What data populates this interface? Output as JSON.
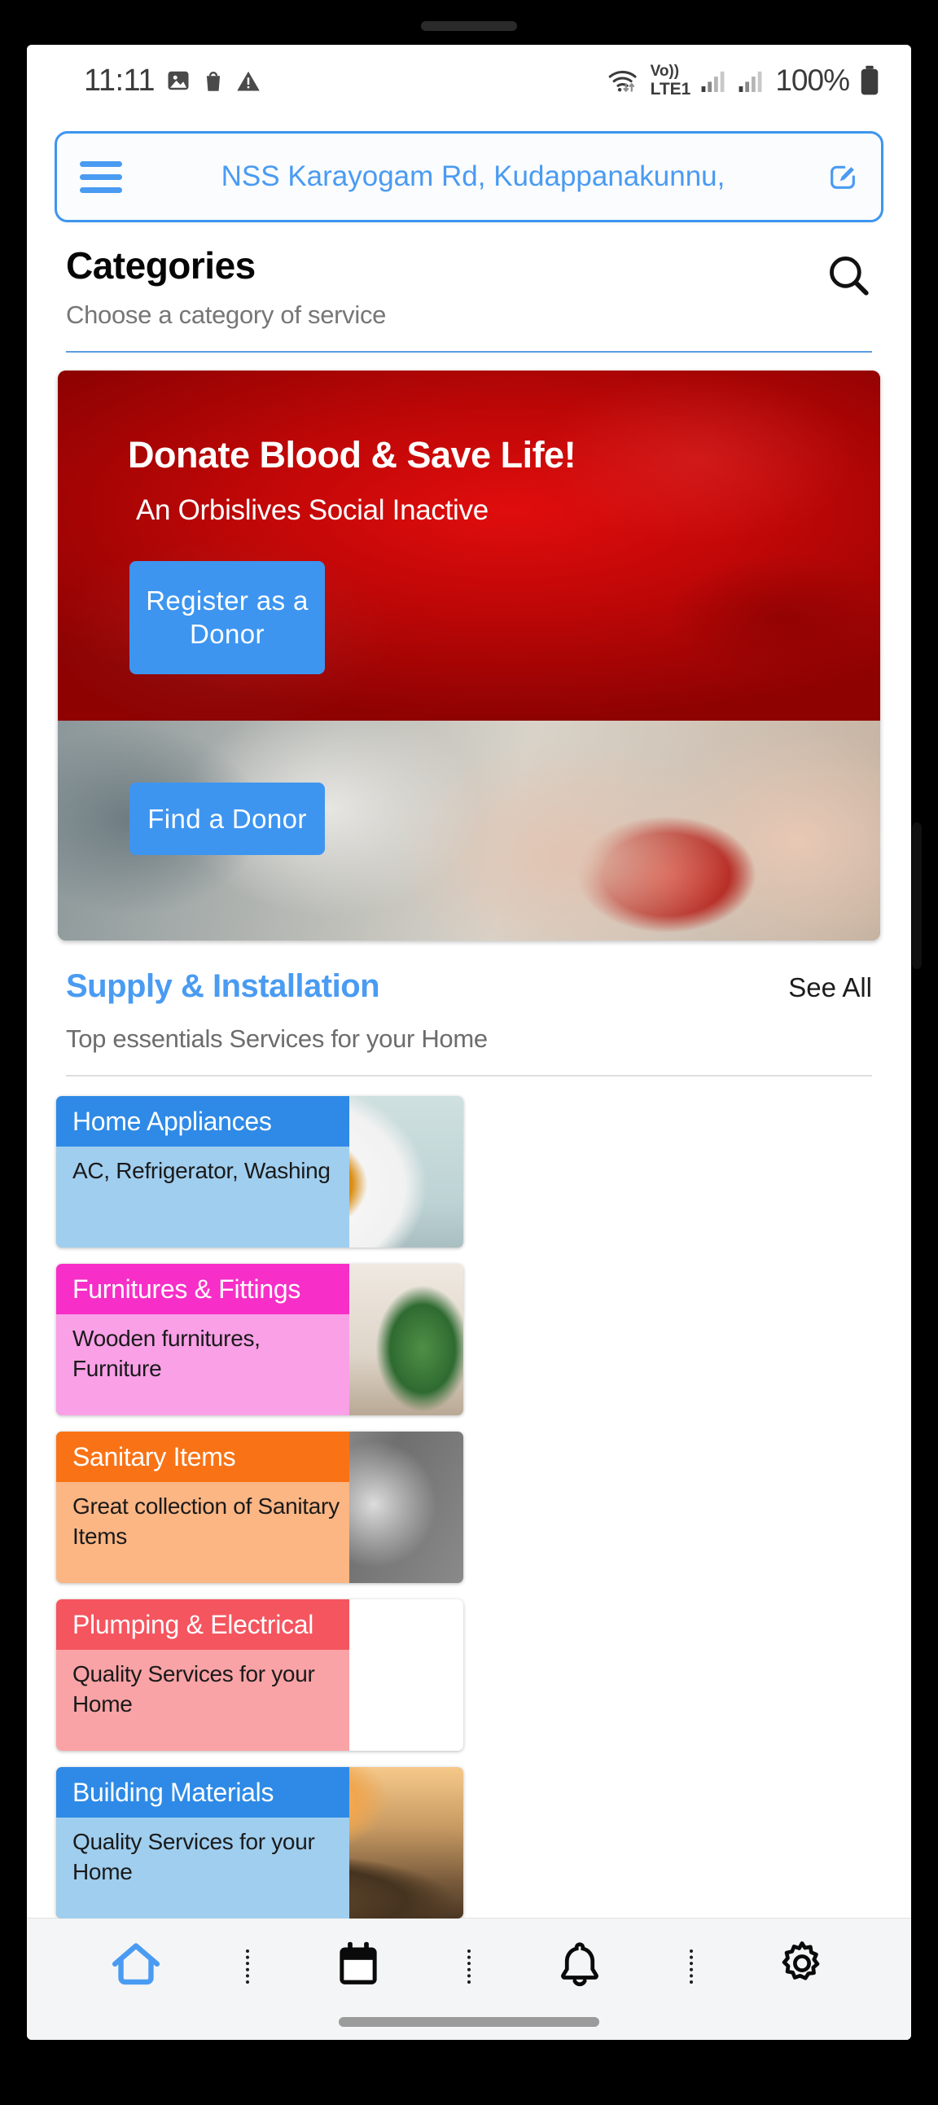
{
  "status_bar": {
    "time": "11:11",
    "left_icons": [
      "image-icon",
      "shopping-bag-icon",
      "warning-icon"
    ],
    "wifi": "wifi-icon",
    "network_label": "Vo))\nLTE1",
    "network_top": "Vo))",
    "network_bottom": "LTE1",
    "signal_1": "signal-bars-icon",
    "signal_2": "signal-bars-icon",
    "battery_percent": "100%",
    "battery_icon": "battery-full-icon"
  },
  "address_bar": {
    "menu_icon": "hamburger-menu-icon",
    "address": "NSS Karayogam Rd, Kudappanakunnu,",
    "edit_icon": "edit-pencil-icon"
  },
  "categories": {
    "title": "Categories",
    "subtitle": "Choose a category of service",
    "search_icon": "search-icon"
  },
  "banner": {
    "heading": "Donate Blood & Save Life!",
    "subheading": "An Orbislives Social Inactive",
    "register_button": "Register as a Donor",
    "find_button": "Find a Donor",
    "background_color": "#c00707",
    "button_color": "#3d95f0"
  },
  "supply": {
    "title": "Supply & Installation",
    "see_all": "See All",
    "subtitle": "Top essentials Services for your Home"
  },
  "cards": [
    {
      "title": "Home Appliances",
      "description": "AC, Refrigerator, Washing",
      "head_color": "#2e8ae6",
      "body_color": "#a0ceef",
      "image": "washing-machine-photo"
    },
    {
      "title": "Furnitures & Fittings",
      "description": "Wooden furnitures, Furniture",
      "head_color": "#f72fc8",
      "body_color": "#f9a0e7",
      "image": "sofa-photo"
    },
    {
      "title": "Sanitary Items",
      "description": "Great collection of Sanitary Items",
      "head_color": "#f97316",
      "body_color": "#fcb684",
      "image": "bathroom-photo"
    },
    {
      "title": "Plumping & Electrical",
      "description": "Quality Services for your Home",
      "head_color": "#f4555f",
      "body_color": "#f9a3a6",
      "image": "plumber-photo"
    },
    {
      "title": "Building Materials",
      "description": "Quality Services for your Home",
      "head_color": "#2e8ae6",
      "body_color": "#a0ceef",
      "image": "railway-tracks-photo"
    }
  ],
  "bottom_nav": [
    {
      "icon": "home-icon",
      "active": true
    },
    {
      "icon": "calendar-icon",
      "active": false
    },
    {
      "icon": "bell-icon",
      "active": false
    },
    {
      "icon": "gear-icon",
      "active": false
    }
  ]
}
